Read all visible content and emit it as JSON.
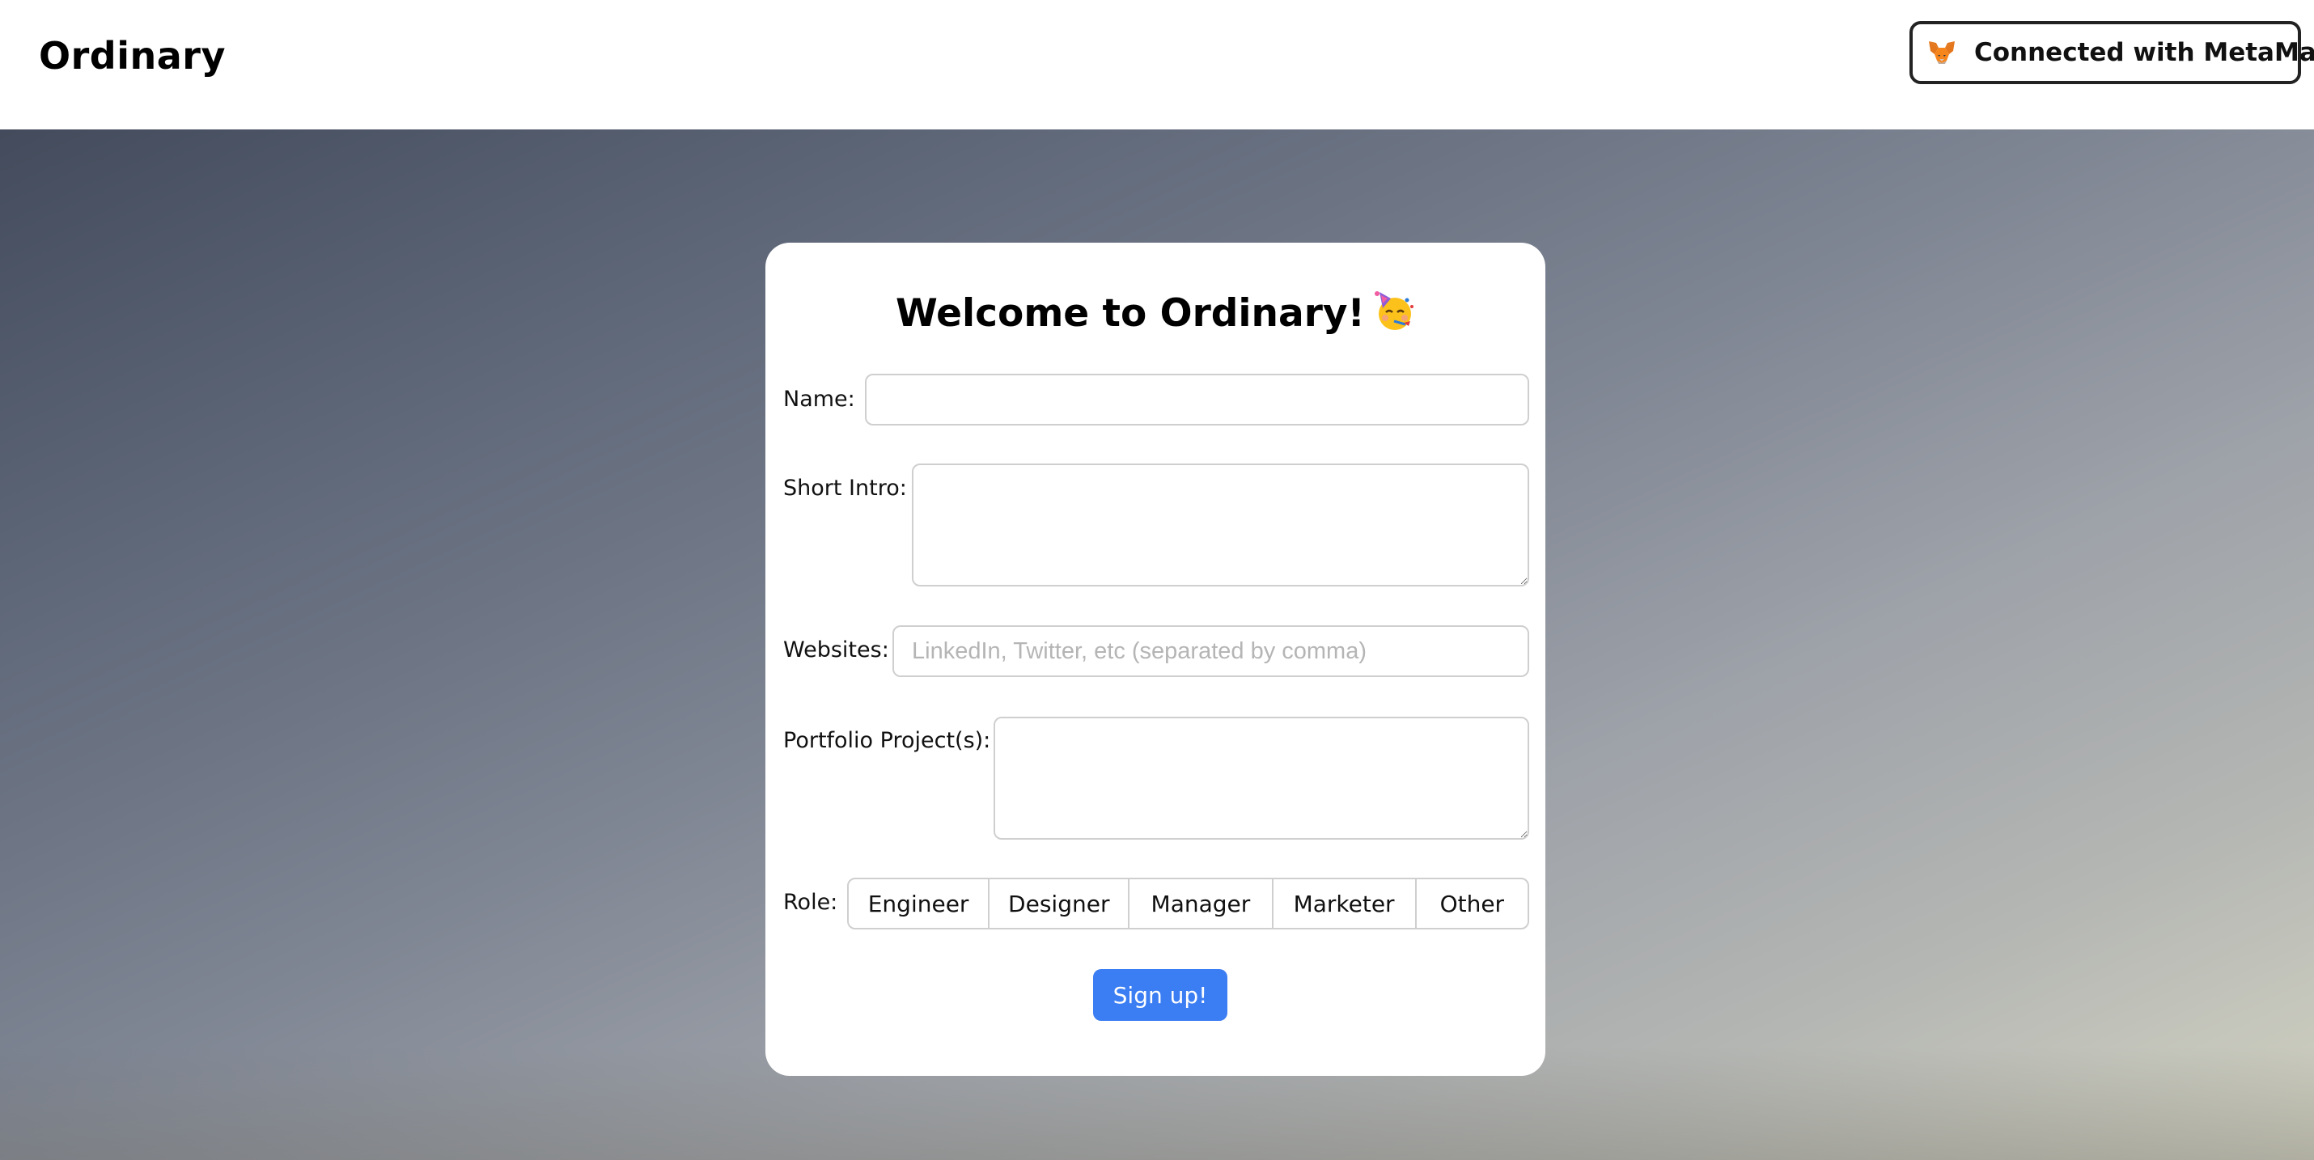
{
  "header": {
    "logo": "Ordinary",
    "wallet_button_label": "Connected with MetaMask",
    "wallet_icon": "metamask-fox-icon"
  },
  "form": {
    "title": "Welcome to Ordinary!",
    "title_icon": "party-face-emoji",
    "name_label": "Name:",
    "name_value": "",
    "intro_label": "Short Intro:",
    "intro_value": "",
    "websites_label": "Websites:",
    "websites_value": "",
    "websites_placeholder": "LinkedIn, Twitter, etc (separated by comma)",
    "portfolio_label": "Portfolio Project(s):",
    "portfolio_value": "",
    "role_label": "Role:",
    "roles": [
      "Engineer",
      "Designer",
      "Manager",
      "Marketer",
      "Other"
    ],
    "submit_label": "Sign up!"
  },
  "colors": {
    "accent": "#3b7df2",
    "header_bg": "#ffffff",
    "card_bg": "#ffffff"
  }
}
